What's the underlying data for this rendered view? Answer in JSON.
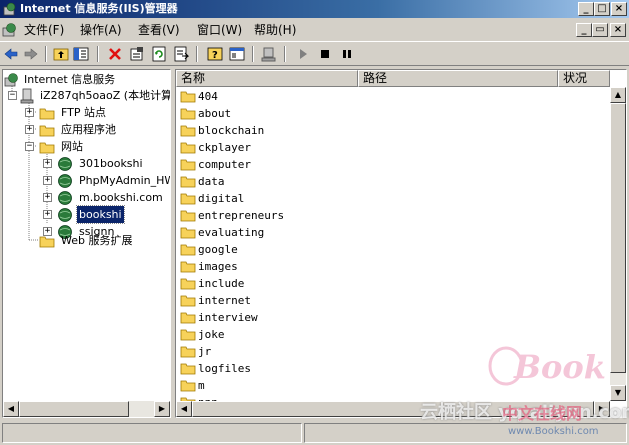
{
  "window": {
    "title": "Internet 信息服务(IIS)管理器",
    "controls": [
      "_",
      "□",
      "×"
    ],
    "mdi_controls": [
      "_",
      "▭",
      "×"
    ]
  },
  "menu": [
    {
      "label": "文件(F)"
    },
    {
      "label": "操作(A)"
    },
    {
      "label": "查看(V)"
    },
    {
      "label": "窗口(W)"
    },
    {
      "label": "帮助(H)"
    }
  ],
  "toolbar": {
    "icons": [
      "back-arrow-icon",
      "forward-arrow-icon",
      "up-folder-icon",
      "show-tree-icon",
      "delete-icon",
      "properties-icon",
      "refresh-icon",
      "export-icon",
      "help-icon",
      "console-icon",
      "server-icon",
      "play-icon",
      "stop-icon",
      "pause-icon"
    ]
  },
  "tree": {
    "root": "Internet 信息服务",
    "server": "iZ287qh5oaoZ (本地计算机)",
    "ftp": "FTP 站点",
    "apppools": "应用程序池",
    "websites": "网站",
    "sites": [
      "301bookshi",
      "PhpMyAdmin_HWS",
      "m.bookshi.com",
      "bookshi",
      "ssignn"
    ],
    "selected_site": "bookshi",
    "webext": "Web 服务扩展"
  },
  "list": {
    "columns": [
      "名称",
      "路径",
      "状况"
    ],
    "items": [
      "404",
      "about",
      "blockchain",
      "ckplayer",
      "computer",
      "data",
      "digital",
      "entrepreneurs",
      "evaluating",
      "google",
      "images",
      "include",
      "internet",
      "interview",
      "joke",
      "jr",
      "logfiles",
      "m",
      "nnn"
    ]
  },
  "watermark": {
    "logo": "Book",
    "text": "云栖社区 yq.aliyun.com",
    "text2": "中文在线网",
    "url": "www.Bookshi.com"
  },
  "colors": {
    "title_start": "#0a246a",
    "title_end": "#a6caf0",
    "selection": "#0a246a",
    "folder": "#f7d25a",
    "globe": "#2a7a3a"
  }
}
